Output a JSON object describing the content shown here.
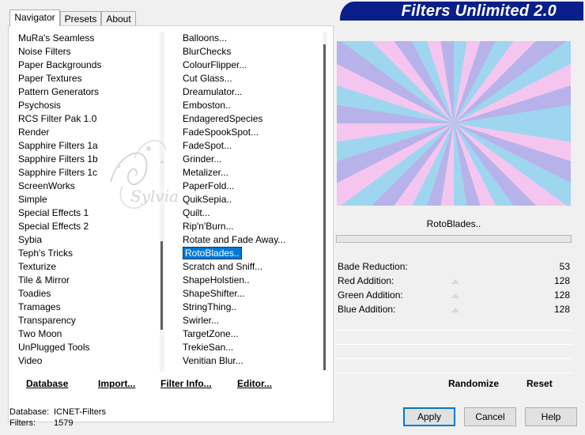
{
  "app": {
    "title": "Filters Unlimited 2.0"
  },
  "tabs": [
    {
      "label": "Navigator",
      "active": true
    },
    {
      "label": "Presets",
      "active": false
    },
    {
      "label": "About",
      "active": false
    }
  ],
  "categories": [
    "MuRa's Seamless",
    "Noise Filters",
    "Paper Backgrounds",
    "Paper Textures",
    "Pattern Generators",
    "Psychosis",
    "RCS Filter Pak 1.0",
    "Render",
    "Sapphire Filters 1a",
    "Sapphire Filters 1b",
    "Sapphire Filters 1c",
    "ScreenWorks",
    "Simple",
    "Special Effects 1",
    "Special Effects 2",
    "Sybia",
    "Teph's Tricks",
    "Texturize",
    "Tile & Mirror",
    "Toadies",
    "Tramages",
    "Transparency",
    "Two Moon",
    "UnPlugged Tools",
    "Video"
  ],
  "filters": [
    "Balloons...",
    "BlurChecks",
    "ColourFlipper...",
    "Cut Glass...",
    "Dreamulator...",
    "Emboston..",
    "EndageredSpecies",
    "FadeSpookSpot...",
    "FadeSpot...",
    "Grinder...",
    "Metalizer...",
    "PaperFold...",
    "QuikSepia..",
    "Quilt...",
    "Rip'n'Burn...",
    "Rotate and Fade Away...",
    "RotoBlades..",
    "Scratch and Sniff...",
    "ShapeHolstien..",
    "ShapeShifter...",
    "StringThing..",
    "Swirler...",
    "TargetZone...",
    "TrekieSan...",
    "Venitian Blur..."
  ],
  "selected_filter": "RotoBlades..",
  "watermark": "Sylvia",
  "preview": {
    "filter_name": "RotoBlades..",
    "colors": [
      "#9fd6ef",
      "#f4c6ef",
      "#b7b3ea"
    ]
  },
  "parameters": [
    {
      "label": "Bade Reduction:",
      "value": "53"
    },
    {
      "label": "Red Addition:",
      "value": "128"
    },
    {
      "label": "Green Addition:",
      "value": "128"
    },
    {
      "label": "Blue Addition:",
      "value": "128"
    }
  ],
  "left_buttons": {
    "database": "Database",
    "import": "Import...",
    "filter_info": "Filter Info...",
    "editor": "Editor..."
  },
  "right_buttons": {
    "randomize": "Randomize",
    "reset": "Reset"
  },
  "status": {
    "database_label": "Database:",
    "database_value": "ICNET-Filters",
    "filters_label": "Filters:",
    "filters_value": "1579"
  },
  "dialog_buttons": {
    "apply": "Apply",
    "cancel": "Cancel",
    "help": "Help"
  }
}
